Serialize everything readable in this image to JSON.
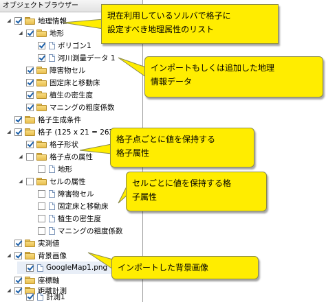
{
  "panel": {
    "title": "オブジェクトブラウザー"
  },
  "tree": [
    {
      "label": "地理情報",
      "checked": true,
      "icon": "folder-icon",
      "expander": "expanded"
    },
    {
      "label": "地形",
      "checked": true,
      "icon": "folder-icon",
      "expander": "expanded"
    },
    {
      "label": "ポリゴン1",
      "checked": true,
      "icon": "document-icon",
      "expander": "none"
    },
    {
      "label": "河川測量データ 1",
      "checked": true,
      "icon": "document-icon",
      "expander": "none"
    },
    {
      "label": "障害物セル",
      "checked": true,
      "icon": "folder-icon",
      "expander": "none"
    },
    {
      "label": "固定床と移動床",
      "checked": true,
      "icon": "folder-icon",
      "expander": "none"
    },
    {
      "label": "植生の密生度",
      "checked": true,
      "icon": "folder-icon",
      "expander": "none"
    },
    {
      "label": "マニングの粗度係数",
      "checked": true,
      "icon": "folder-icon",
      "expander": "none"
    },
    {
      "label": "格子生成条件",
      "checked": true,
      "icon": "folder-icon",
      "expander": "none"
    },
    {
      "label": "格子 (125 x 21 = 2625)",
      "checked": true,
      "icon": "folder-icon",
      "expander": "expanded"
    },
    {
      "label": "格子形状",
      "checked": true,
      "icon": "folder-icon",
      "expander": "none"
    },
    {
      "label": "格子点の属性",
      "checked": false,
      "icon": "folder-icon",
      "expander": "expanded"
    },
    {
      "label": "地形",
      "checked": false,
      "icon": "document-icon",
      "expander": "none"
    },
    {
      "label": "セルの属性",
      "checked": false,
      "icon": "folder-icon",
      "expander": "expanded"
    },
    {
      "label": "障害物セル",
      "checked": false,
      "icon": "document-icon",
      "expander": "none"
    },
    {
      "label": "固定床と移動床",
      "checked": false,
      "icon": "document-icon",
      "expander": "none"
    },
    {
      "label": "植生の密生度",
      "checked": false,
      "icon": "document-icon",
      "expander": "none"
    },
    {
      "label": "マニングの粗度係数",
      "checked": false,
      "icon": "document-icon",
      "expander": "none"
    },
    {
      "label": "実測値",
      "checked": true,
      "icon": "folder-icon",
      "expander": "none"
    },
    {
      "label": "背景画像",
      "checked": true,
      "icon": "folder-icon",
      "expander": "expanded"
    },
    {
      "label": "GoogleMap1.png",
      "checked": true,
      "icon": "document-icon",
      "expander": "none"
    },
    {
      "label": "座標軸",
      "checked": true,
      "icon": "folder-icon",
      "expander": "none"
    },
    {
      "label": "距離計測",
      "checked": true,
      "icon": "folder-icon",
      "expander": "expanded"
    },
    {
      "label": "計測1",
      "checked": true,
      "icon": "document-icon",
      "expander": "none"
    }
  ],
  "callouts": {
    "geo": [
      "現在利用しているソルバで格子に",
      "設定すべき地理属性のリスト"
    ],
    "import": [
      "インポートもしくは追加した地理",
      "情報データ"
    ],
    "gridpoint": [
      "格子点ごとに値を保持する",
      "格子属性"
    ],
    "cell": [
      "セルごとに値を保持する格",
      "子属性"
    ],
    "background": [
      "インポートした背景画像"
    ]
  },
  "colors": {
    "callout": "#ffed00",
    "check": "#1a5ea8",
    "folder": "#f8dc82"
  }
}
